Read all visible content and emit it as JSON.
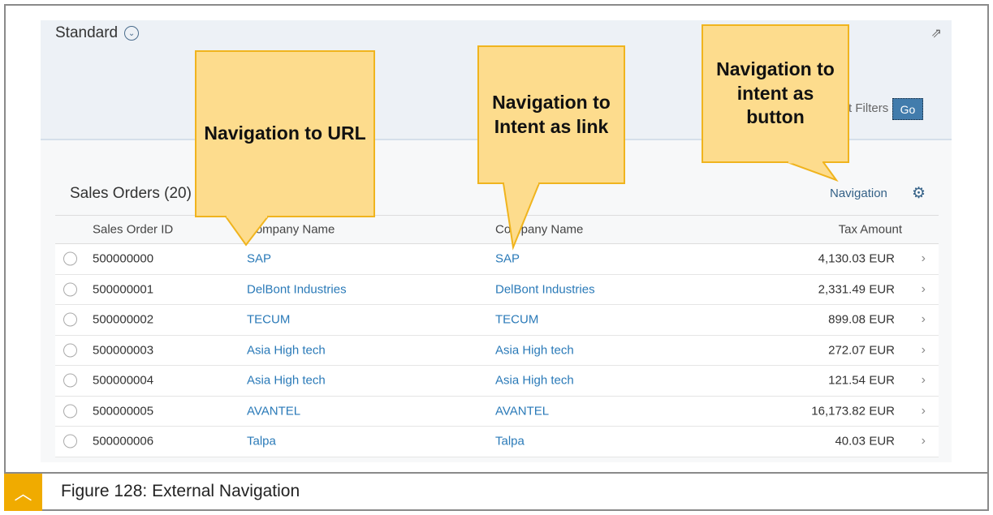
{
  "header": {
    "variant": "Standard",
    "filters_label": "Adapt Filters",
    "go_label": "Go"
  },
  "table": {
    "title": "Sales Orders (20)",
    "navigation_button": "Navigation",
    "columns": [
      "Sales Order ID",
      "Company Name",
      "Company Name",
      "Tax Amount"
    ],
    "rows": [
      {
        "id": "500000000",
        "company_url": "SAP",
        "company_intent": "SAP",
        "tax": "4,130.03",
        "currency": "EUR"
      },
      {
        "id": "500000001",
        "company_url": "DelBont Industries",
        "company_intent": "DelBont Industries",
        "tax": "2,331.49",
        "currency": "EUR"
      },
      {
        "id": "500000002",
        "company_url": "TECUM",
        "company_intent": "TECUM",
        "tax": "899.08",
        "currency": "EUR"
      },
      {
        "id": "500000003",
        "company_url": "Asia High tech",
        "company_intent": "Asia High tech",
        "tax": "272.07",
        "currency": "EUR"
      },
      {
        "id": "500000004",
        "company_url": "Asia High tech",
        "company_intent": "Asia High tech",
        "tax": "121.54",
        "currency": "EUR"
      },
      {
        "id": "500000005",
        "company_url": "AVANTEL",
        "company_intent": "AVANTEL",
        "tax": "16,173.82",
        "currency": "EUR"
      },
      {
        "id": "500000006",
        "company_url": "Talpa",
        "company_intent": "Talpa",
        "tax": "40.03",
        "currency": "EUR"
      }
    ]
  },
  "callouts": [
    "Navigation to URL",
    "Navigation to Intent as link",
    "Navigation to intent as button"
  ],
  "caption": "Figure 128: External Navigation"
}
